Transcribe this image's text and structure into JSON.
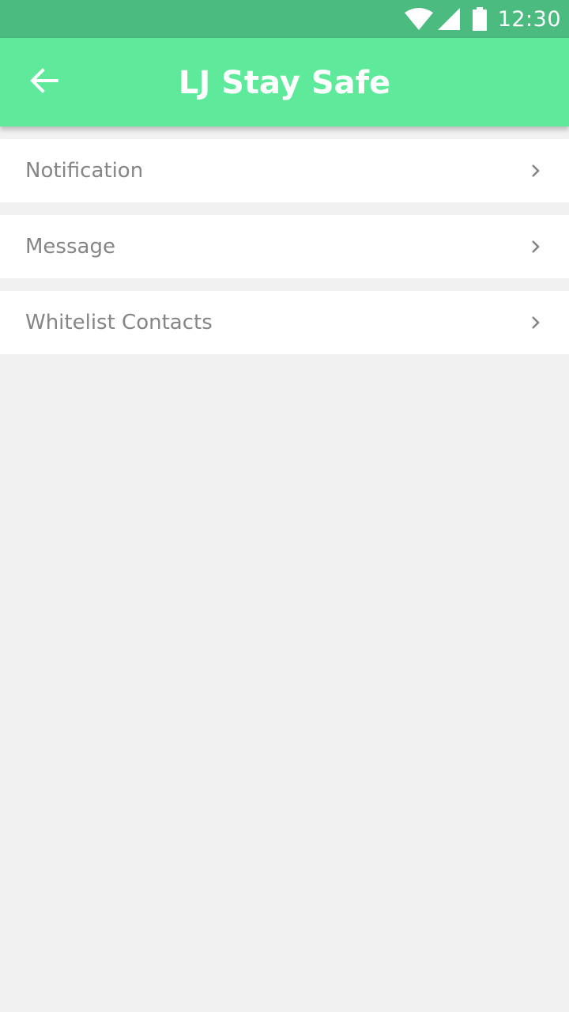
{
  "status_bar": {
    "time": "12:30",
    "icons": [
      "wifi-icon",
      "cell-signal-icon",
      "battery-icon"
    ],
    "background": "#4bbb7f"
  },
  "app_bar": {
    "title": "LJ Stay Safe",
    "back_icon": "arrow-left-icon",
    "background": "#5fe99a"
  },
  "menu": {
    "items": [
      {
        "label": "Notification",
        "icon": "chevron-right-icon"
      },
      {
        "label": "Message",
        "icon": "chevron-right-icon"
      },
      {
        "label": "Whitelist Contacts",
        "icon": "chevron-right-icon"
      }
    ]
  },
  "colors": {
    "page_background": "#f1f1f1",
    "item_background": "#ffffff",
    "item_text": "#858585"
  }
}
